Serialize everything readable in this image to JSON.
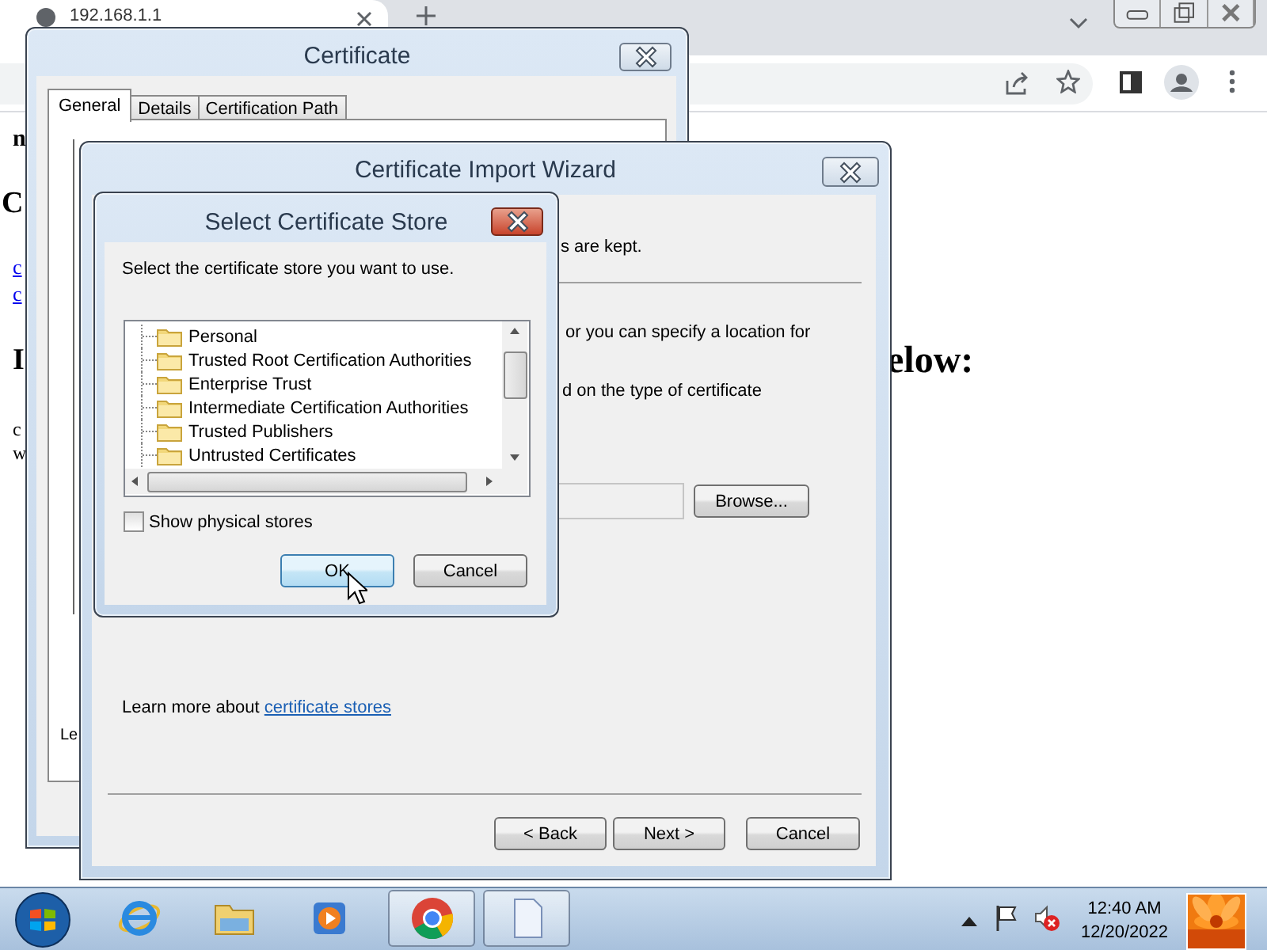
{
  "browser": {
    "tab_title": "192.168.1.1"
  },
  "page": {
    "fragments": [
      {
        "kind": "bold",
        "text": "n"
      },
      {
        "kind": "heading",
        "text": "C"
      },
      {
        "kind": "link",
        "text": "c"
      },
      {
        "kind": "link",
        "text": "c"
      },
      {
        "kind": "heading",
        "text": "I"
      },
      {
        "kind": "plain",
        "text": "c"
      },
      {
        "kind": "plain",
        "text": "w"
      },
      {
        "kind": "heading",
        "text": "elow:"
      }
    ]
  },
  "certificate_window": {
    "title": "Certificate",
    "tabs": [
      {
        "label": "General",
        "selected": true
      },
      {
        "label": "Details",
        "selected": false
      },
      {
        "label": "Certification Path",
        "selected": false
      }
    ],
    "fragment": "Le"
  },
  "wizard": {
    "title": "Certificate Import Wizard",
    "fragments": [
      "s are kept.",
      "or you can specify a location for",
      "d on the type of certificate"
    ],
    "browse_button": "Browse...",
    "learn_more": "Learn more about ",
    "learn_more_link": "certificate stores",
    "buttons": [
      "< Back",
      "Next >",
      "Cancel"
    ]
  },
  "store_dialog": {
    "title": "Select Certificate Store",
    "prompt": "Select the certificate store you want to use.",
    "stores": [
      {
        "label": "Personal",
        "selected": false
      },
      {
        "label": "Trusted Root Certification Authorities",
        "selected": false
      },
      {
        "label": "Enterprise Trust",
        "selected": false
      },
      {
        "label": "Intermediate Certification Authorities",
        "selected": false
      },
      {
        "label": "Trusted Publishers",
        "selected": false
      },
      {
        "label": "Untrusted Certificates",
        "selected": false
      }
    ],
    "show_physical": {
      "label": "Show physical stores",
      "checked": false
    },
    "buttons": [
      {
        "label": "OK",
        "default": true
      },
      {
        "label": "Cancel",
        "default": false
      }
    ]
  },
  "taskbar": {
    "apps": [
      {
        "kind": "ie",
        "active": false
      },
      {
        "kind": "explorer",
        "active": false
      },
      {
        "kind": "media",
        "active": false
      },
      {
        "kind": "chrome",
        "active": true
      },
      {
        "kind": "document",
        "active": true
      }
    ],
    "time": "12:40 AM",
    "date": "12/20/2022"
  }
}
